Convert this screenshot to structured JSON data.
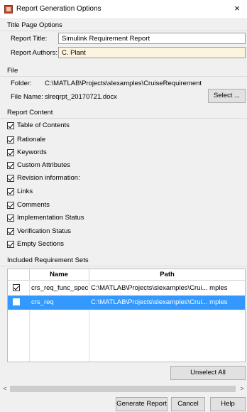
{
  "window": {
    "title": "Report Generation Options",
    "icon": "report-app-icon",
    "close_glyph": "×"
  },
  "title_page": {
    "header": "Title Page Options",
    "report_title_label": "Report Title:",
    "report_title_value": "Simulink Requirement Report",
    "report_authors_label": "Report Authors:",
    "report_authors_value": "C. Plant"
  },
  "file": {
    "header": "File",
    "folder_label": "Folder:",
    "folder_value": "C:\\MATLAB\\Projects\\slexamples\\CruiseRequirement",
    "filename_label": "File Name:",
    "filename_value": "slreqrpt_20170721.docx",
    "select_button": "Select ..."
  },
  "report_content": {
    "header": "Report Content",
    "items": [
      {
        "label": "Table of Contents",
        "checked": true
      },
      {
        "label": "Rationale",
        "checked": true
      },
      {
        "label": "Keywords",
        "checked": true
      },
      {
        "label": "Custom Attributes",
        "checked": true
      },
      {
        "label": "Revision information:",
        "checked": true
      },
      {
        "label": "Links",
        "checked": true
      },
      {
        "label": "Comments",
        "checked": true
      },
      {
        "label": "Implementation Status",
        "checked": true
      },
      {
        "label": "Verification Status",
        "checked": true
      },
      {
        "label": "Empty Sections",
        "checked": true
      }
    ]
  },
  "requirement_sets": {
    "header": "Included Requirement Sets",
    "columns": [
      "Name",
      "Path"
    ],
    "rows": [
      {
        "checked": true,
        "name": "crs_req_func_spec",
        "path": "C:\\MATLAB\\Projects\\slexamples\\Crui... mples",
        "selected": false
      },
      {
        "checked": false,
        "name": "crs_req",
        "path": "C:\\MATLAB\\Projects\\slexamples\\Crui... mples",
        "selected": true
      }
    ],
    "unselect_all_button": "Unselect All"
  },
  "scrollbar": {
    "left_arrow": "<",
    "right_arrow": ">"
  },
  "footer": {
    "generate_button": "Generate Report",
    "cancel_button": "Cancel",
    "help_button": "Help"
  },
  "colors": {
    "selection": "#3399ff",
    "authors_field_bg": "#fdf4e0",
    "app_icon": "#c84b2c"
  }
}
